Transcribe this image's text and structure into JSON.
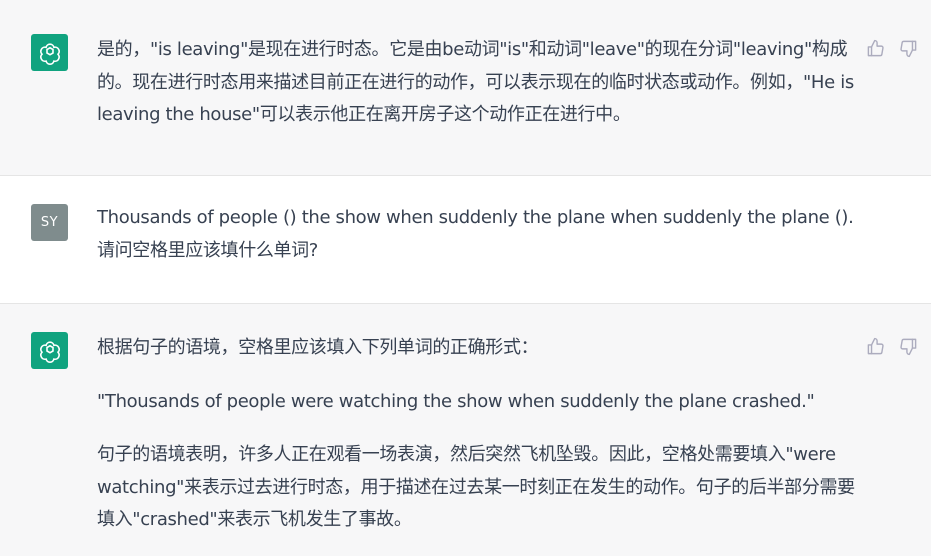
{
  "messages": [
    {
      "role": "assistant",
      "paragraphs": [
        "是的，\"is leaving\"是现在进行时态。它是由be动词\"is\"和动词\"leave\"的现在分词\"leaving\"构成的。现在进行时态用来描述目前正在进行的动作，可以表示现在的临时状态或动作。例如，\"He is leaving the house\"可以表示他正在离开房子这个动作正在进行中。"
      ]
    },
    {
      "role": "user",
      "avatar_initials": "SY",
      "paragraphs": [
        "Thousands of people () the show when suddenly the plane when suddenly the plane ().请问空格里应该填什么单词?"
      ]
    },
    {
      "role": "assistant",
      "paragraphs": [
        "根据句子的语境，空格里应该填入下列单词的正确形式：",
        "\"Thousands of people were watching the show when suddenly the plane crashed.\"",
        "句子的语境表明，许多人正在观看一场表演，然后突然飞机坠毁。因此，空格处需要填入\"were watching\"来表示过去进行时态，用于描述在过去某一时刻正在发生的动作。句子的后半部分需要填入\"crashed\"来表示飞机发生了事故。"
      ]
    }
  ],
  "icons": {
    "assistant_avatar": "openai-logo-icon",
    "thumbs_up": "thumbs-up-icon",
    "thumbs_down": "thumbs-down-icon"
  },
  "colors": {
    "assistant_bg": "#f7f7f8",
    "user_bg": "#ffffff",
    "gpt_green": "#10a37f",
    "user_avatar_bg": "#7f8c8d",
    "text": "#374151",
    "icon_gray": "#acacbe"
  }
}
